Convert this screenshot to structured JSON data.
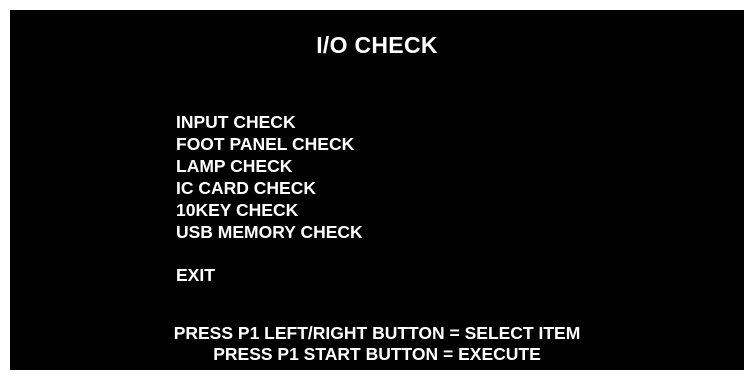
{
  "screen": {
    "title": "I/O CHECK",
    "menu_items": [
      "INPUT CHECK",
      "FOOT PANEL CHECK",
      "LAMP CHECK",
      "IC CARD CHECK",
      "10KEY CHECK",
      "USB MEMORY CHECK"
    ],
    "exit_label": "EXIT",
    "instructions": [
      "PRESS P1 LEFT/RIGHT BUTTON = SELECT ITEM",
      "PRESS P1 START BUTTON = EXECUTE"
    ]
  },
  "colors": {
    "background": "#000000",
    "text": "#ffffff",
    "border": "#ffffff"
  }
}
